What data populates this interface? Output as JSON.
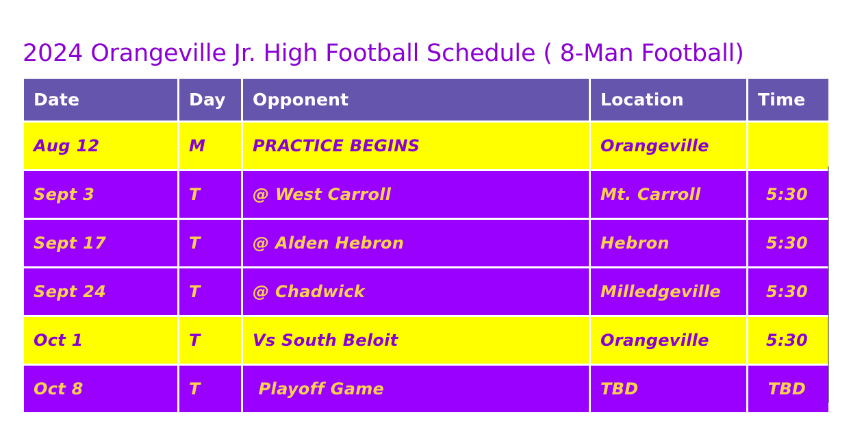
{
  "title": "2024 Orangeville Jr. High Football Schedule ( 8-Man Football)",
  "colors": {
    "title_text": "#8a00d4",
    "header_bg": "#6655ad",
    "header_text": "#ffffff",
    "row_yellow_bg": "#ffff00",
    "row_yellow_text": "#8a00d4",
    "row_purple_bg": "#9900ff",
    "row_purple_text": "#ffd24d",
    "page_bg": "#ffffff"
  },
  "table": {
    "columns": [
      {
        "key": "date",
        "label": "Date"
      },
      {
        "key": "day",
        "label": "Day"
      },
      {
        "key": "opponent",
        "label": "Opponent"
      },
      {
        "key": "location",
        "label": "Location"
      },
      {
        "key": "time",
        "label": "Time"
      }
    ],
    "rows": [
      {
        "style": "yellow",
        "date": "Aug 12",
        "day": "M",
        "opponent": "PRACTICE BEGINS",
        "location": "Orangeville",
        "time": ""
      },
      {
        "style": "purple",
        "date": "Sept 3",
        "day": "T",
        "opponent": "@ West Carroll",
        "location": "Mt. Carroll",
        "time": "5:30"
      },
      {
        "style": "purple",
        "date": "Sept 17",
        "day": "T",
        "opponent": "@ Alden Hebron",
        "location": "Hebron",
        "time": "5:30"
      },
      {
        "style": "purple",
        "date": "Sept 24",
        "day": "T",
        "opponent": "@ Chadwick",
        "location": "Milledgeville",
        "time": "5:30"
      },
      {
        "style": "yellow",
        "date": "Oct 1",
        "day": "T",
        "opponent": "Vs South Beloit",
        "location": "Orangeville",
        "time": "5:30"
      },
      {
        "style": "purple",
        "date": "Oct 8",
        "day": "T",
        "opponent": " Playoff Game",
        "location": "TBD",
        "time": "TBD"
      }
    ]
  }
}
